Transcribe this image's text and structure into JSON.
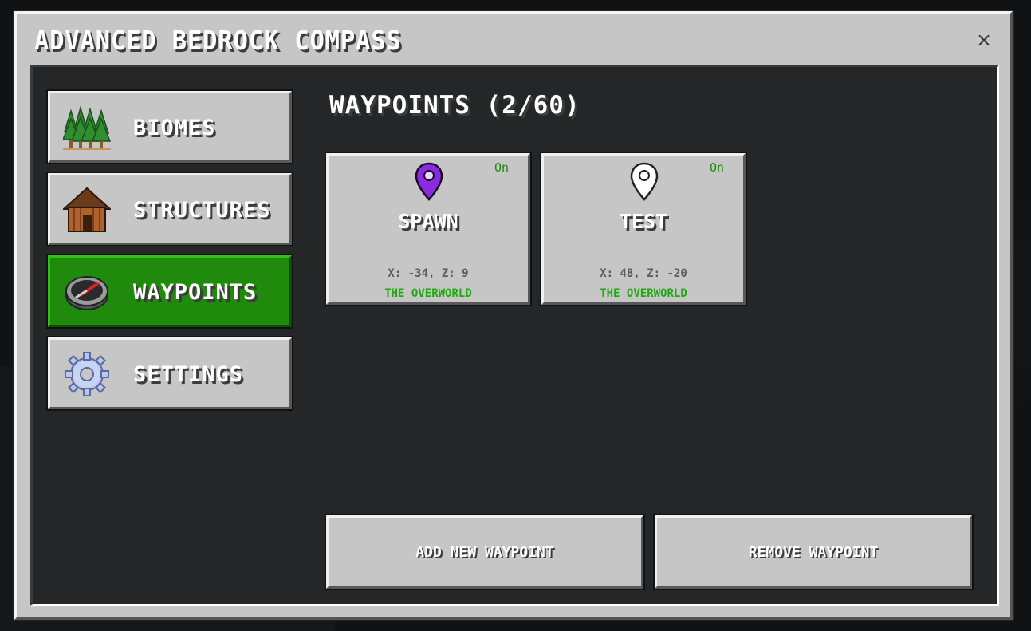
{
  "window": {
    "title": "ADVANCED BEDROCK COMPASS",
    "close_glyph": "×"
  },
  "sidebar": {
    "items": [
      {
        "label": "BIOMES",
        "icon": "trees-icon",
        "active": false
      },
      {
        "label": "STRUCTURES",
        "icon": "house-icon",
        "active": false
      },
      {
        "label": "WAYPOINTS",
        "icon": "compass-icon",
        "active": true
      },
      {
        "label": "SETTINGS",
        "icon": "gear-icon",
        "active": false
      }
    ]
  },
  "main": {
    "title": "WAYPOINTS (2/60)",
    "waypoints": [
      {
        "name": "SPAWN",
        "status": "On",
        "coords": "X: -34, Z: 9",
        "dimension": "THE OVERWORLD",
        "pin_color": "#8a2be2"
      },
      {
        "name": "TEST",
        "status": "On",
        "coords": "X: 48, Z: -20",
        "dimension": "THE OVERWORLD",
        "pin_color": "#ffffff"
      }
    ],
    "actions": {
      "add_label": "ADD NEW WAYPOINT",
      "remove_label": "REMOVE WAYPOINT"
    }
  },
  "colors": {
    "active_green": "#1f8a0b",
    "panel_gray": "#c6c6c6",
    "dimension_green": "#1fa80f"
  }
}
